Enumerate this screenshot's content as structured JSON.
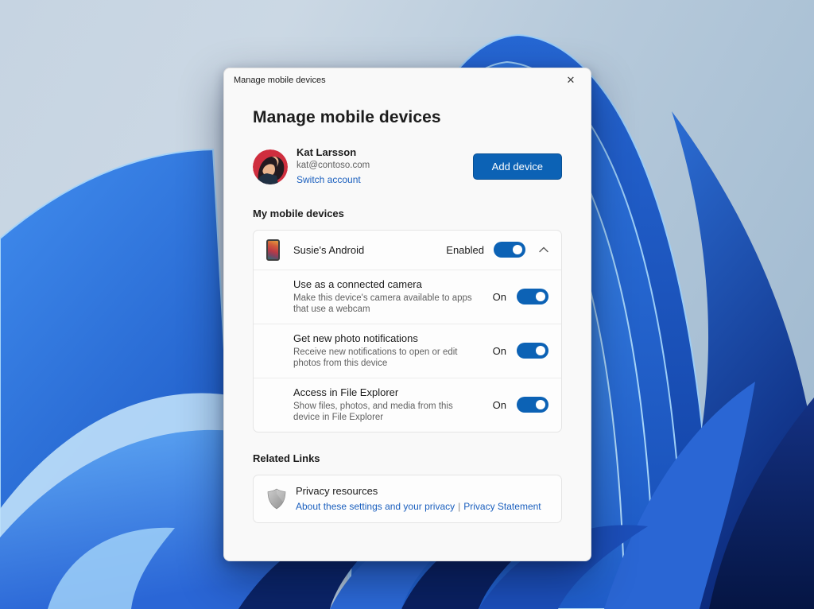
{
  "icons": {
    "close": "✕",
    "chevron_up": "chevron-up",
    "shield": "shield",
    "phone": "phone-thumbnail"
  },
  "colors": {
    "accent": "#0c62b5",
    "link": "#1a5fbe"
  },
  "titlebar": {
    "title": "Manage mobile devices"
  },
  "main": {
    "heading": "Manage mobile devices"
  },
  "profile": {
    "name": "Kat Larsson",
    "email": "kat@contoso.com",
    "switch_account": "Switch account",
    "add_device": "Add device"
  },
  "devices": {
    "section_label": "My mobile devices",
    "device": {
      "name": "Susie's Android",
      "status": "Enabled",
      "state": "on"
    },
    "settings": [
      {
        "title": "Use as a connected camera",
        "description": "Make this device's camera available to apps that use a webcam",
        "toggle": "On",
        "state": "on"
      },
      {
        "title": "Get new photo notifications",
        "description": "Receive new notifications to open or edit photos from this device",
        "toggle": "On",
        "state": "on"
      },
      {
        "title": "Access in File Explorer",
        "description": "Show files, photos, and media from this device in File Explorer",
        "toggle": "On",
        "state": "on"
      }
    ]
  },
  "related": {
    "section_label": "Related Links",
    "privacy": {
      "title": "Privacy resources",
      "link_about": "About these settings and your privacy",
      "separator": "|",
      "link_statement": "Privacy Statement"
    }
  }
}
